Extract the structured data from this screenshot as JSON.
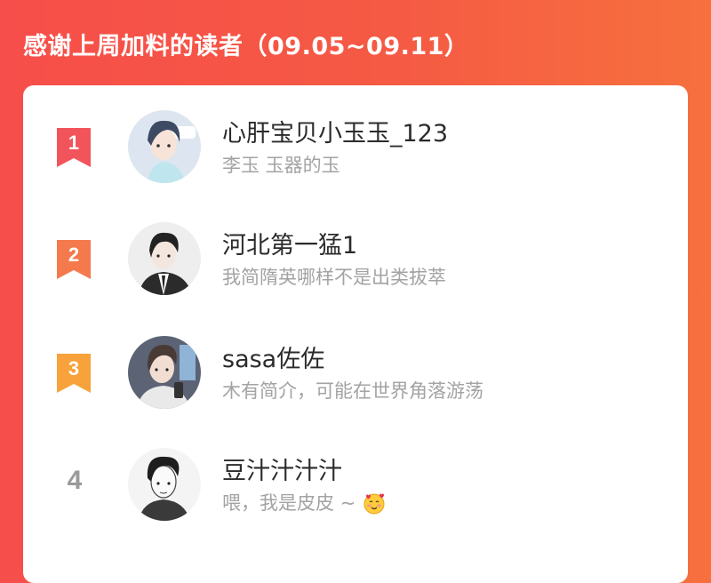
{
  "header": {
    "title": "感谢上周加料的读者（09.05~09.11）"
  },
  "colors": {
    "rank1": "#f2545b",
    "rank2": "#f47a4e",
    "rank3": "#f7a23a",
    "rank_plain": "#9a9a9a"
  },
  "readers": [
    {
      "rank": "1",
      "name": "心肝宝贝小玉玉_123",
      "bio": "李玉 玉器的玉",
      "avatar_icon": "anime-boy-avatar"
    },
    {
      "rank": "2",
      "name": "河北第一猛1",
      "bio": "我简隋英哪样不是出类拔萃",
      "avatar_icon": "anime-man-suit-avatar"
    },
    {
      "rank": "3",
      "name": "sasa佐佐",
      "bio": "木有简介，可能在世界角落游荡",
      "avatar_icon": "anime-man-phone-avatar"
    },
    {
      "rank": "4",
      "name": "豆汁汁汁汁",
      "bio": "喂，我是皮皮 ~",
      "avatar_icon": "sketch-man-avatar",
      "emoji": "smiling-face-hearts-emoji"
    }
  ]
}
